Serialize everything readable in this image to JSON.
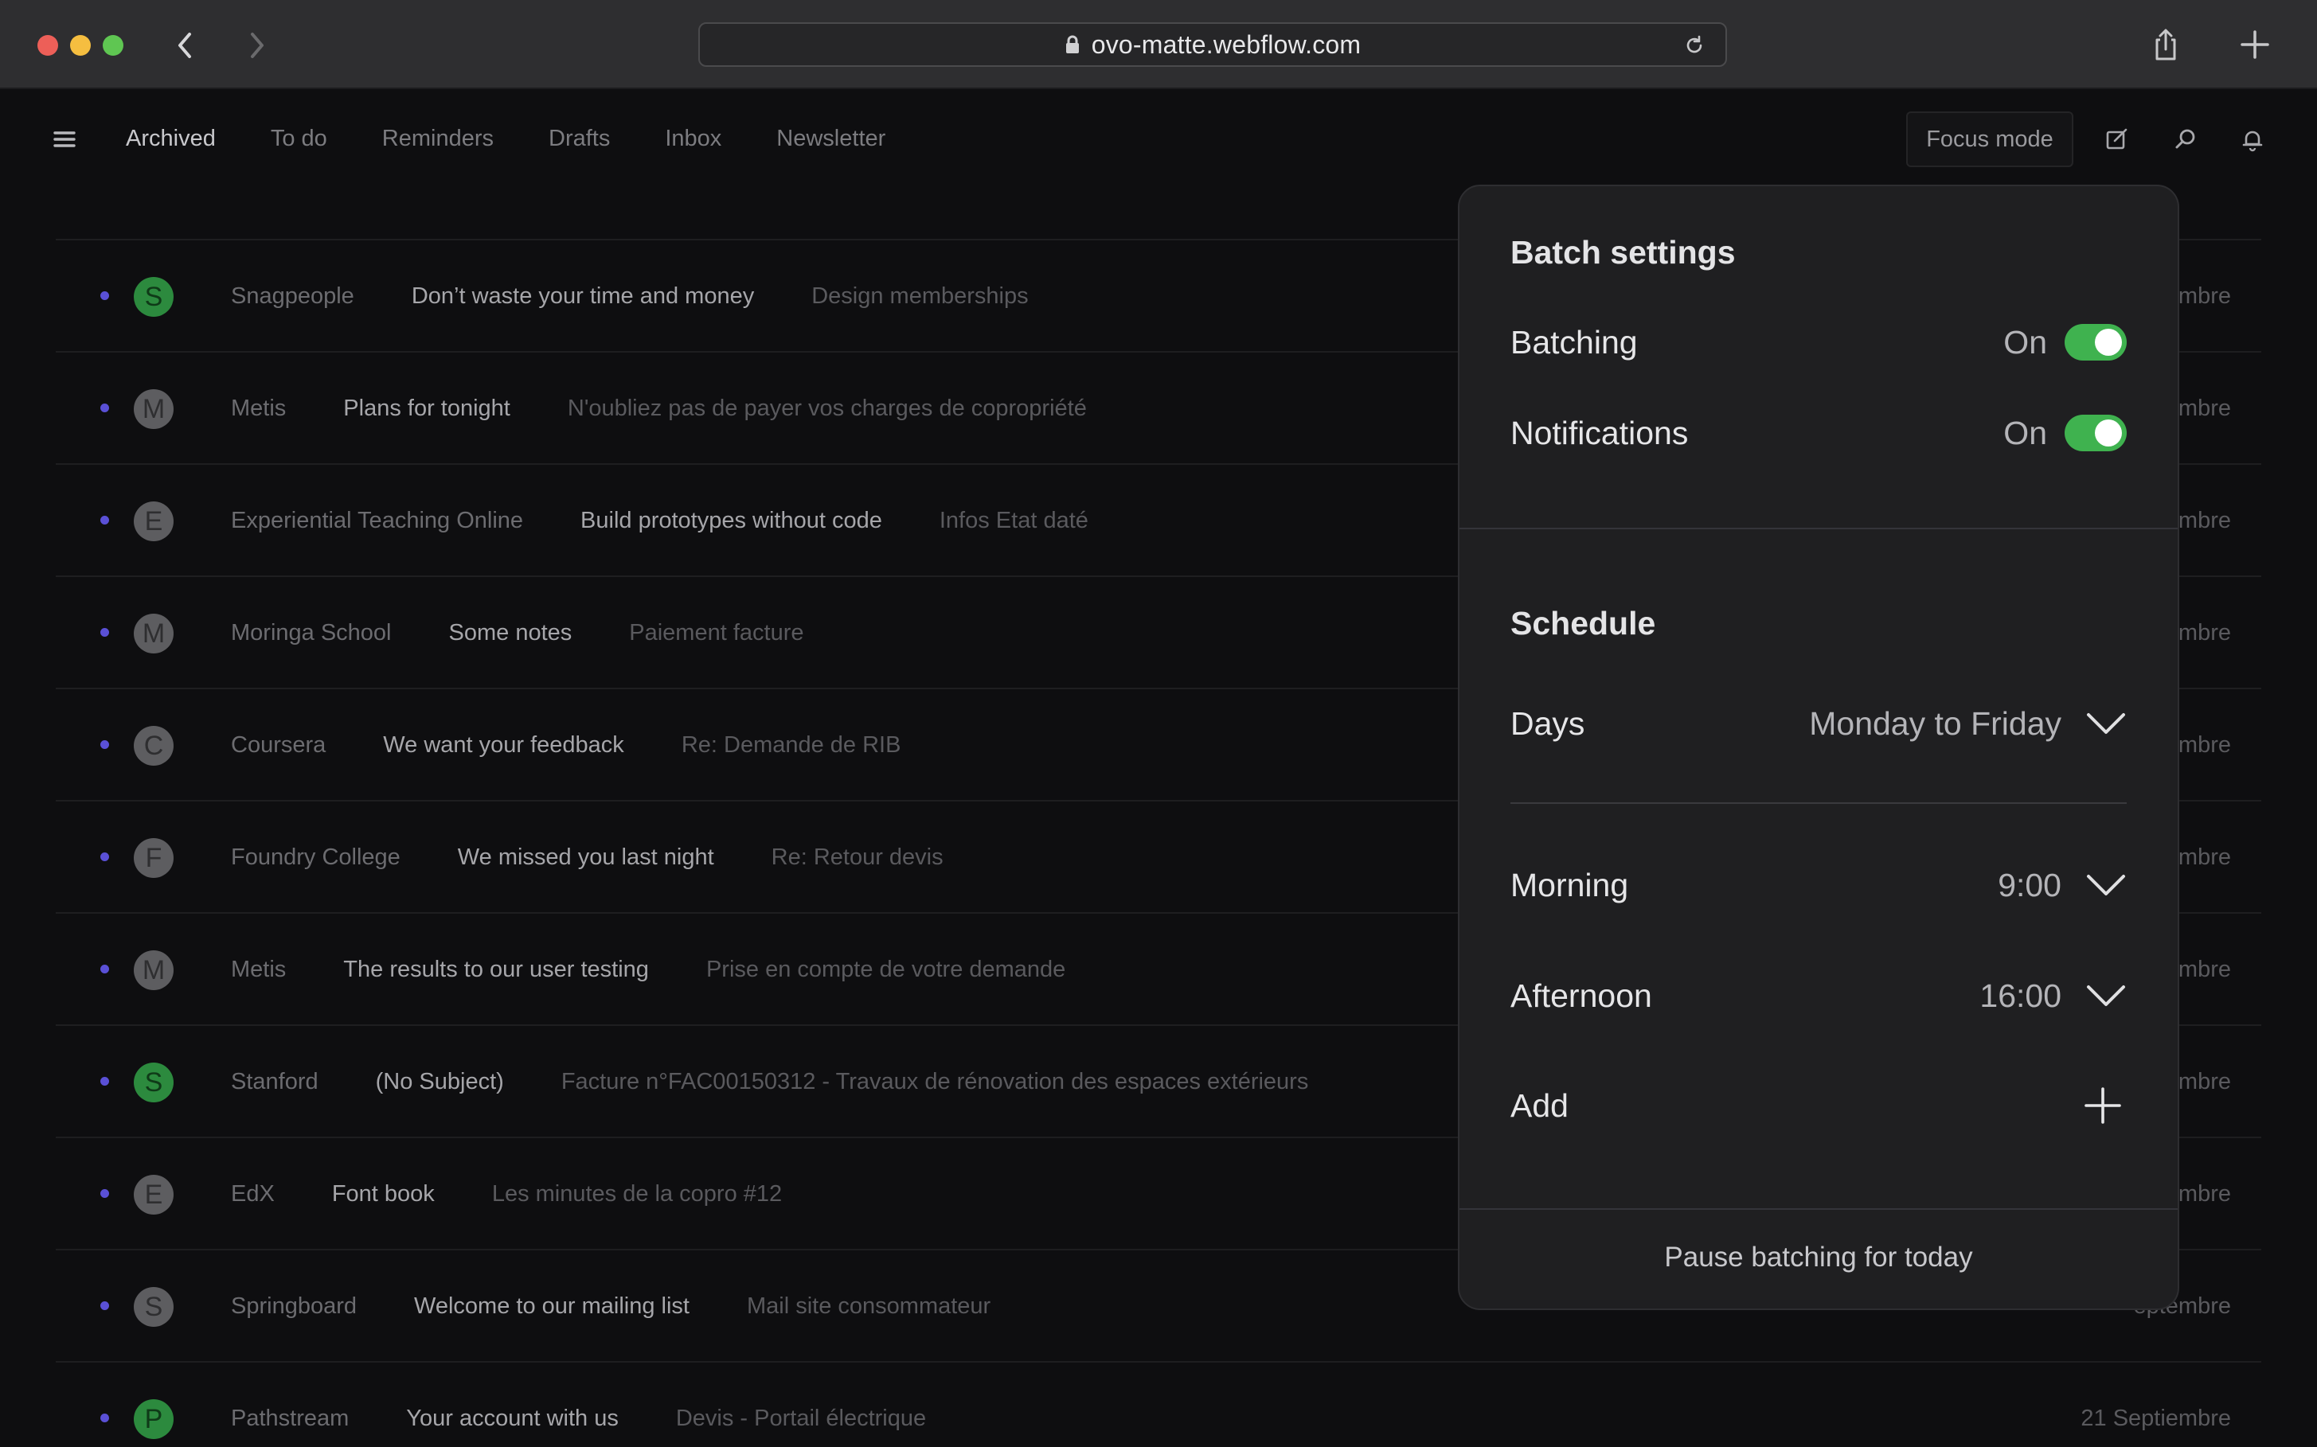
{
  "browser": {
    "url": "ovo-matte.webflow.com"
  },
  "header": {
    "tabs": [
      {
        "label": "Archived",
        "active": true
      },
      {
        "label": "To do",
        "active": false
      },
      {
        "label": "Reminders",
        "active": false
      },
      {
        "label": "Drafts",
        "active": false
      },
      {
        "label": "Inbox",
        "active": false
      },
      {
        "label": "Newsletter",
        "active": false
      }
    ],
    "focus_mode_label": "Focus mode"
  },
  "emails": [
    {
      "initial": "S",
      "avatar_color": "green",
      "sender": "Snagpeople",
      "subject": "Don’t waste your time and money",
      "preview": "Design memberships",
      "date": "mbre"
    },
    {
      "initial": "M",
      "avatar_color": "gray",
      "sender": "Metis",
      "subject": "Plans for tonight",
      "preview": "N'oubliez pas de payer vos charges de copropriété",
      "date": "mbre"
    },
    {
      "initial": "E",
      "avatar_color": "gray",
      "sender": "Experiential Teaching Online",
      "subject": "Build prototypes without code",
      "preview": "Infos Etat daté",
      "date": "mbre"
    },
    {
      "initial": "M",
      "avatar_color": "gray",
      "sender": "Moringa School",
      "subject": "Some notes",
      "preview": "Paiement facture",
      "date": "mbre"
    },
    {
      "initial": "C",
      "avatar_color": "gray",
      "sender": "Coursera",
      "subject": "We want your feedback",
      "preview": "Re: Demande de RIB",
      "date": "mbre"
    },
    {
      "initial": "F",
      "avatar_color": "gray",
      "sender": "Foundry College",
      "subject": "We missed you last night",
      "preview": "Re: Retour devis",
      "date": "mbre"
    },
    {
      "initial": "M",
      "avatar_color": "gray",
      "sender": "Metis",
      "subject": "The results to our user testing",
      "preview": "Prise en compte de votre demande",
      "date": "mbre"
    },
    {
      "initial": "S",
      "avatar_color": "green",
      "sender": "Stanford",
      "subject": "(No Subject)",
      "preview": "Facture n°FAC00150312 - Travaux de rénovation des espaces extérieurs",
      "date": "mbre"
    },
    {
      "initial": "E",
      "avatar_color": "gray",
      "sender": "EdX",
      "subject": "Font book",
      "preview": "Les minutes de la copro #12",
      "date": "mbre"
    },
    {
      "initial": "S",
      "avatar_color": "gray",
      "sender": "Springboard",
      "subject": "Welcome to our mailing list",
      "preview": "Mail site consommateur",
      "date": "eptembre"
    },
    {
      "initial": "P",
      "avatar_color": "green",
      "sender": "Pathstream",
      "subject": "Your account with us",
      "preview": "Devis - Portail électrique",
      "date": "21 Septiembre"
    }
  ],
  "batch_panel": {
    "title": "Batch settings",
    "batching": {
      "label": "Batching",
      "value": "On"
    },
    "notifications": {
      "label": "Notifications",
      "value": "On"
    },
    "schedule_title": "Schedule",
    "days": {
      "label": "Days",
      "value": "Monday to Friday"
    },
    "morning": {
      "label": "Morning",
      "value": "9:00"
    },
    "afternoon": {
      "label": "Afternoon",
      "value": "16:00"
    },
    "add_label": "Add",
    "pause_label": "Pause batching for today"
  },
  "colors": {
    "toggle_on": "#3fb24f",
    "unread_dot": "#5a50d6",
    "avatar_green": "#2c8a3e"
  }
}
